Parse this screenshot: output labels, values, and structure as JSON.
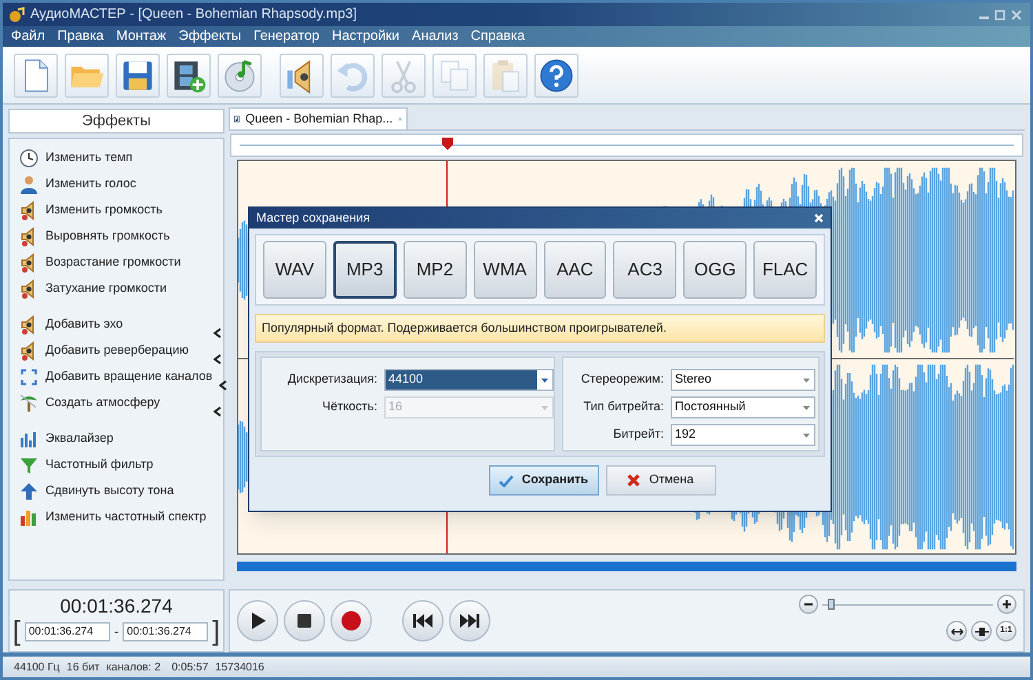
{
  "window": {
    "title": "АудиоМАСТЕР - [Queen - Bohemian Rhapsody.mp3]"
  },
  "menu": [
    "Файл",
    "Правка",
    "Монтаж",
    "Эффекты",
    "Генератор",
    "Настройки",
    "Анализ",
    "Справка"
  ],
  "toolbar": [
    [
      {
        "kind": "new",
        "disabled": false
      },
      {
        "kind": "open",
        "disabled": false
      },
      {
        "kind": "save",
        "disabled": false
      },
      {
        "kind": "video",
        "disabled": false
      },
      {
        "kind": "disc",
        "disabled": false
      }
    ],
    [
      {
        "kind": "volume",
        "disabled": false
      },
      {
        "kind": "undo",
        "disabled": true
      },
      {
        "kind": "cut",
        "disabled": true
      },
      {
        "kind": "copy",
        "disabled": true
      },
      {
        "kind": "paste",
        "disabled": true
      },
      {
        "kind": "help",
        "disabled": false
      }
    ]
  ],
  "effects_panel": {
    "title": "Эффекты",
    "groups": [
      [
        {
          "label": "Изменить темп",
          "kind": "tempo",
          "submenu": false
        },
        {
          "label": "Изменить голос",
          "kind": "voice",
          "submenu": false
        },
        {
          "label": "Изменить громкость",
          "kind": "volume",
          "submenu": false
        },
        {
          "label": "Выровнять громкость",
          "kind": "volume",
          "submenu": false
        },
        {
          "label": "Возрастание громкости",
          "kind": "volume",
          "submenu": false
        },
        {
          "label": "Затухание громкости",
          "kind": "volume",
          "submenu": false
        }
      ],
      [
        {
          "label": "Добавить эхо",
          "kind": "volume",
          "submenu": true
        },
        {
          "label": "Добавить реверберацию",
          "kind": "volume",
          "submenu": true
        },
        {
          "label": "Добавить вращение каналов",
          "kind": "rotation",
          "submenu": true
        },
        {
          "label": "Создать атмосферу",
          "kind": "atmosphere",
          "submenu": true
        }
      ],
      [
        {
          "label": "Эквалайзер",
          "kind": "equalizer",
          "submenu": false
        },
        {
          "label": "Частотный фильтр",
          "kind": "filter",
          "submenu": false
        },
        {
          "label": "Сдвинуть высоту тона",
          "kind": "pitch",
          "submenu": false
        },
        {
          "label": "Изменить частотный спектр",
          "kind": "spectrum",
          "submenu": false
        }
      ]
    ]
  },
  "tab": {
    "label": "Queen - Bohemian Rhap..."
  },
  "dialog": {
    "title": "Мастер сохранения",
    "formats": [
      {
        "label": "WAV",
        "selected": false
      },
      {
        "label": "MP3",
        "selected": true
      },
      {
        "label": "MP2",
        "selected": false
      },
      {
        "label": "WMA",
        "selected": false
      },
      {
        "label": "AAC",
        "selected": false
      },
      {
        "label": "AC3",
        "selected": false
      },
      {
        "label": "OGG",
        "selected": false
      },
      {
        "label": "FLAC",
        "selected": false
      }
    ],
    "info": "Популярный формат. Подерживается большинством проигрывателей.",
    "left_fields": [
      {
        "label": "Дискретизация:",
        "value": "44100",
        "focused": true,
        "disabled": false
      },
      {
        "label": "Чёткость:",
        "value": "16",
        "focused": false,
        "disabled": true
      }
    ],
    "right_fields": [
      {
        "label": "Стереорежим:",
        "value": "Stereo",
        "focused": false,
        "disabled": false
      },
      {
        "label": "Тип битрейта:",
        "value": "Постоянный",
        "focused": false,
        "disabled": false
      },
      {
        "label": "Битрейт:",
        "value": "192",
        "focused": false,
        "disabled": false
      }
    ],
    "buttons": [
      {
        "label": "Сохранить",
        "kind": "save",
        "default": true
      },
      {
        "label": "Отмена",
        "kind": "cancel",
        "default": false
      }
    ]
  },
  "position": {
    "time": "00:01:36.274",
    "bracket_open": "[",
    "start": "00:01:36.274",
    "separator": "-",
    "end": "00:01:36.274",
    "bracket_close": "]"
  },
  "transport": [
    {
      "kind": "play"
    },
    {
      "kind": "stop"
    },
    {
      "kind": "record"
    },
    {
      "kind": "previous"
    },
    {
      "kind": "next"
    }
  ],
  "zoom": {
    "level": 0.03
  },
  "view_buttons": [
    {
      "kind": "fit"
    },
    {
      "kind": "selection"
    },
    {
      "kind": "actual",
      "label": "1:1"
    }
  ],
  "status_bar": [
    "44100 Гц",
    "16 бит",
    "каналов: 2",
    "0:05:57",
    "15734016"
  ]
}
